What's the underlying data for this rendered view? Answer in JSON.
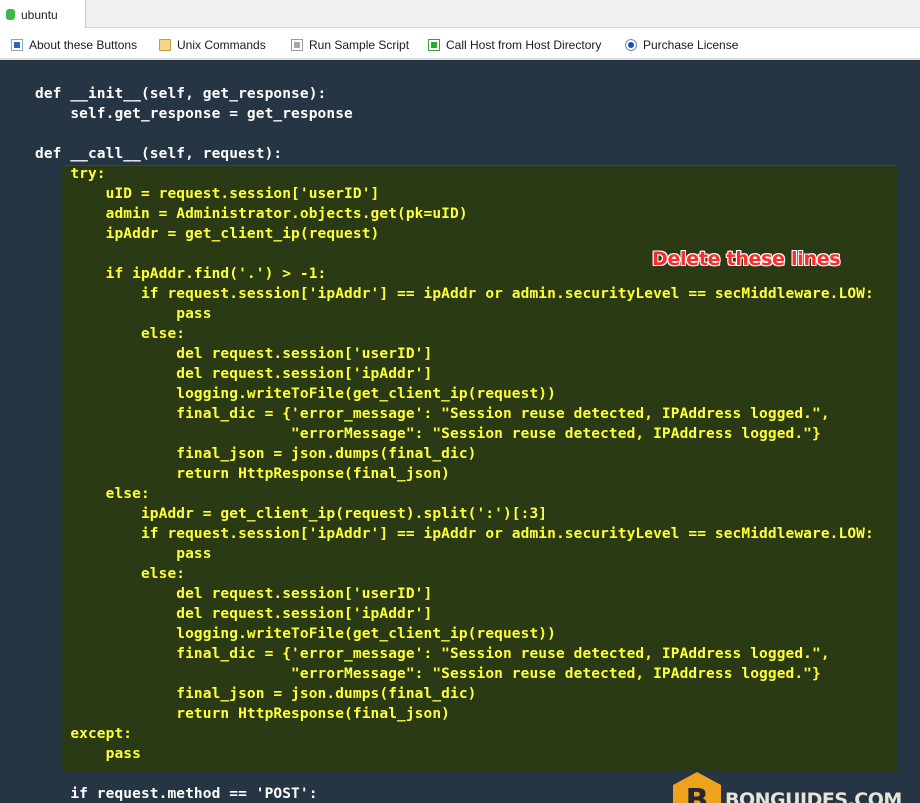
{
  "window": {
    "tab_title": "ubuntu"
  },
  "toolbar": {
    "items": [
      {
        "label": "About these Buttons",
        "icon": "info-square-icon"
      },
      {
        "label": "Unix Commands",
        "icon": "folder-icon"
      },
      {
        "label": "Run Sample Script",
        "icon": "script-icon"
      },
      {
        "label": "Call Host from Host Directory",
        "icon": "host-icon"
      },
      {
        "label": "Purchase License",
        "icon": "radio-license-icon"
      }
    ]
  },
  "colors": {
    "background": "#263544",
    "highlight_background": "#2a3a14",
    "highlight_text": "#ffff38",
    "normal_text": "#ffffff",
    "annotation": "#ff2a2a",
    "tab_status": "#3cb84a"
  },
  "annotation": "Delete these lines",
  "watermark": {
    "letter": "B",
    "text": "BONGUIDES.COM"
  },
  "code": {
    "lines": [
      {
        "text": "def __init__(self, get_response):",
        "hl": false
      },
      {
        "text": "    self.get_response = get_response",
        "hl": false
      },
      {
        "text": "",
        "hl": false
      },
      {
        "text": "def __call__(self, request):",
        "hl": false
      },
      {
        "text": "    try:",
        "hl": true
      },
      {
        "text": "        uID = request.session['userID']",
        "hl": true
      },
      {
        "text": "        admin = Administrator.objects.get(pk=uID)",
        "hl": true
      },
      {
        "text": "        ipAddr = get_client_ip(request)",
        "hl": true
      },
      {
        "text": "",
        "hl": true
      },
      {
        "text": "        if ipAddr.find('.') > -1:",
        "hl": true
      },
      {
        "text": "            if request.session['ipAddr'] == ipAddr or admin.securityLevel == secMiddleware.LOW:",
        "hl": true
      },
      {
        "text": "                pass",
        "hl": true
      },
      {
        "text": "            else:",
        "hl": true
      },
      {
        "text": "                del request.session['userID']",
        "hl": true
      },
      {
        "text": "                del request.session['ipAddr']",
        "hl": true
      },
      {
        "text": "                logging.writeToFile(get_client_ip(request))",
        "hl": true
      },
      {
        "text": "                final_dic = {'error_message': \"Session reuse detected, IPAddress logged.\",",
        "hl": true
      },
      {
        "text": "                             \"errorMessage\": \"Session reuse detected, IPAddress logged.\"}",
        "hl": true
      },
      {
        "text": "                final_json = json.dumps(final_dic)",
        "hl": true
      },
      {
        "text": "                return HttpResponse(final_json)",
        "hl": true
      },
      {
        "text": "        else:",
        "hl": true
      },
      {
        "text": "            ipAddr = get_client_ip(request).split(':')[:3]",
        "hl": true
      },
      {
        "text": "            if request.session['ipAddr'] == ipAddr or admin.securityLevel == secMiddleware.LOW:",
        "hl": true
      },
      {
        "text": "                pass",
        "hl": true
      },
      {
        "text": "            else:",
        "hl": true
      },
      {
        "text": "                del request.session['userID']",
        "hl": true
      },
      {
        "text": "                del request.session['ipAddr']",
        "hl": true
      },
      {
        "text": "                logging.writeToFile(get_client_ip(request))",
        "hl": true
      },
      {
        "text": "                final_dic = {'error_message': \"Session reuse detected, IPAddress logged.\",",
        "hl": true
      },
      {
        "text": "                             \"errorMessage\": \"Session reuse detected, IPAddress logged.\"}",
        "hl": true
      },
      {
        "text": "                final_json = json.dumps(final_dic)",
        "hl": true
      },
      {
        "text": "                return HttpResponse(final_json)",
        "hl": true
      },
      {
        "text": "    except:",
        "hl": true
      },
      {
        "text": "        pass",
        "hl": true
      },
      {
        "text": "",
        "hl": false
      },
      {
        "text": "    if request.method == 'POST':",
        "hl": false
      }
    ]
  }
}
